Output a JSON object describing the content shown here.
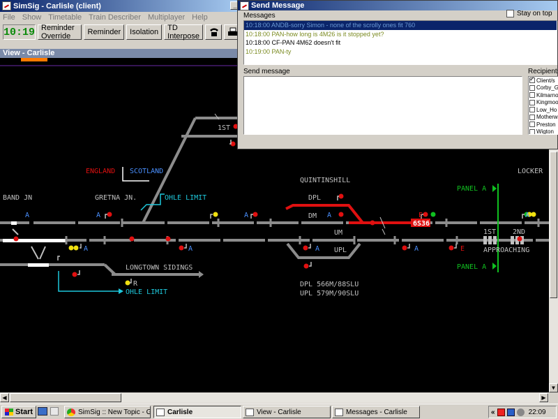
{
  "main_window": {
    "title": "SimSig - Carlisle (client)",
    "menu": [
      "File",
      "Show",
      "Timetable",
      "Train Describer",
      "Multiplayer",
      "Help"
    ],
    "clock": "10:19",
    "buttons": [
      "Reminder Override",
      "Reminder",
      "Isolation",
      "TD Interpose"
    ]
  },
  "view": {
    "title": "View - Carlisle",
    "labels": {
      "band_jn": "BAND JN",
      "gretna_jn": "GRETNA JN.",
      "england": "ENGLAND",
      "scotland": "SCOTLAND",
      "ohle_limit_1": "OHLE LIMIT",
      "ohle_limit_2": "OHLE LIMIT",
      "quintinshill": "QUINTINSHILL",
      "dpl": "DPL",
      "dm": "DM",
      "um": "UM",
      "upl": "UPL",
      "longtown": "LONGTOWN SIDINGS",
      "first_top": "1ST",
      "lockerbie": "LOCKER",
      "panel_a_top": "PANEL A",
      "panel_a_bottom": "PANEL A",
      "first": "1ST",
      "second": "2ND",
      "approaching": "APPROACHING",
      "dpl_mileage": "DPL 566M/88SLU",
      "upl_mileage": "UPL 579M/90SLU",
      "train_headcode": "6S36"
    },
    "signals": [
      "A",
      "A",
      "A",
      "A",
      "A",
      "A",
      "A",
      "A",
      "A",
      "E",
      "E",
      "R"
    ],
    "colors": {
      "track": "#8c8c8c",
      "route_set": "#e01010",
      "text": "#c0c0c0",
      "cyan": "#1ec8dc",
      "green": "#10c020",
      "blue": "#4a90ff"
    }
  },
  "dialog": {
    "title": "Send Message",
    "messages_label": "Messages",
    "stay_on_top": "Stay on top",
    "messages": [
      {
        "text": "10:18:00 ANDB-sorry Simon - none of the scrolly ones fit 760",
        "color": "#6c9bd6",
        "selected": true
      },
      {
        "text": "10:18:00 PAN-how long is 4M26 is it stopped yet?",
        "color": "#7a8a20",
        "selected": false
      },
      {
        "text": "10:18:00 CF-PAN 4M62 doesn't fit",
        "color": "#000000",
        "selected": false
      },
      {
        "text": "10:19:00 PAN-ty",
        "color": "#7a8a20",
        "selected": false
      }
    ],
    "send_label": "Send message",
    "recipients_label": "Recipients",
    "recipients": [
      {
        "name": "Client/s",
        "checked": true
      },
      {
        "name": "Corby_G",
        "checked": false
      },
      {
        "name": "Kilmarno",
        "checked": false
      },
      {
        "name": "Kingmoo",
        "checked": false
      },
      {
        "name": "Low_Ho",
        "checked": false
      },
      {
        "name": "Motherw",
        "checked": false
      },
      {
        "name": "Preston",
        "checked": false
      },
      {
        "name": "Wigton",
        "checked": false
      }
    ]
  },
  "taskbar": {
    "start": "Start",
    "tasks": [
      "SimSig :: New Topic - Go...",
      "Carlisle",
      "View - Carlisle",
      "Messages - Carlisle"
    ],
    "tray_arrow": "«",
    "time": "22:09"
  }
}
